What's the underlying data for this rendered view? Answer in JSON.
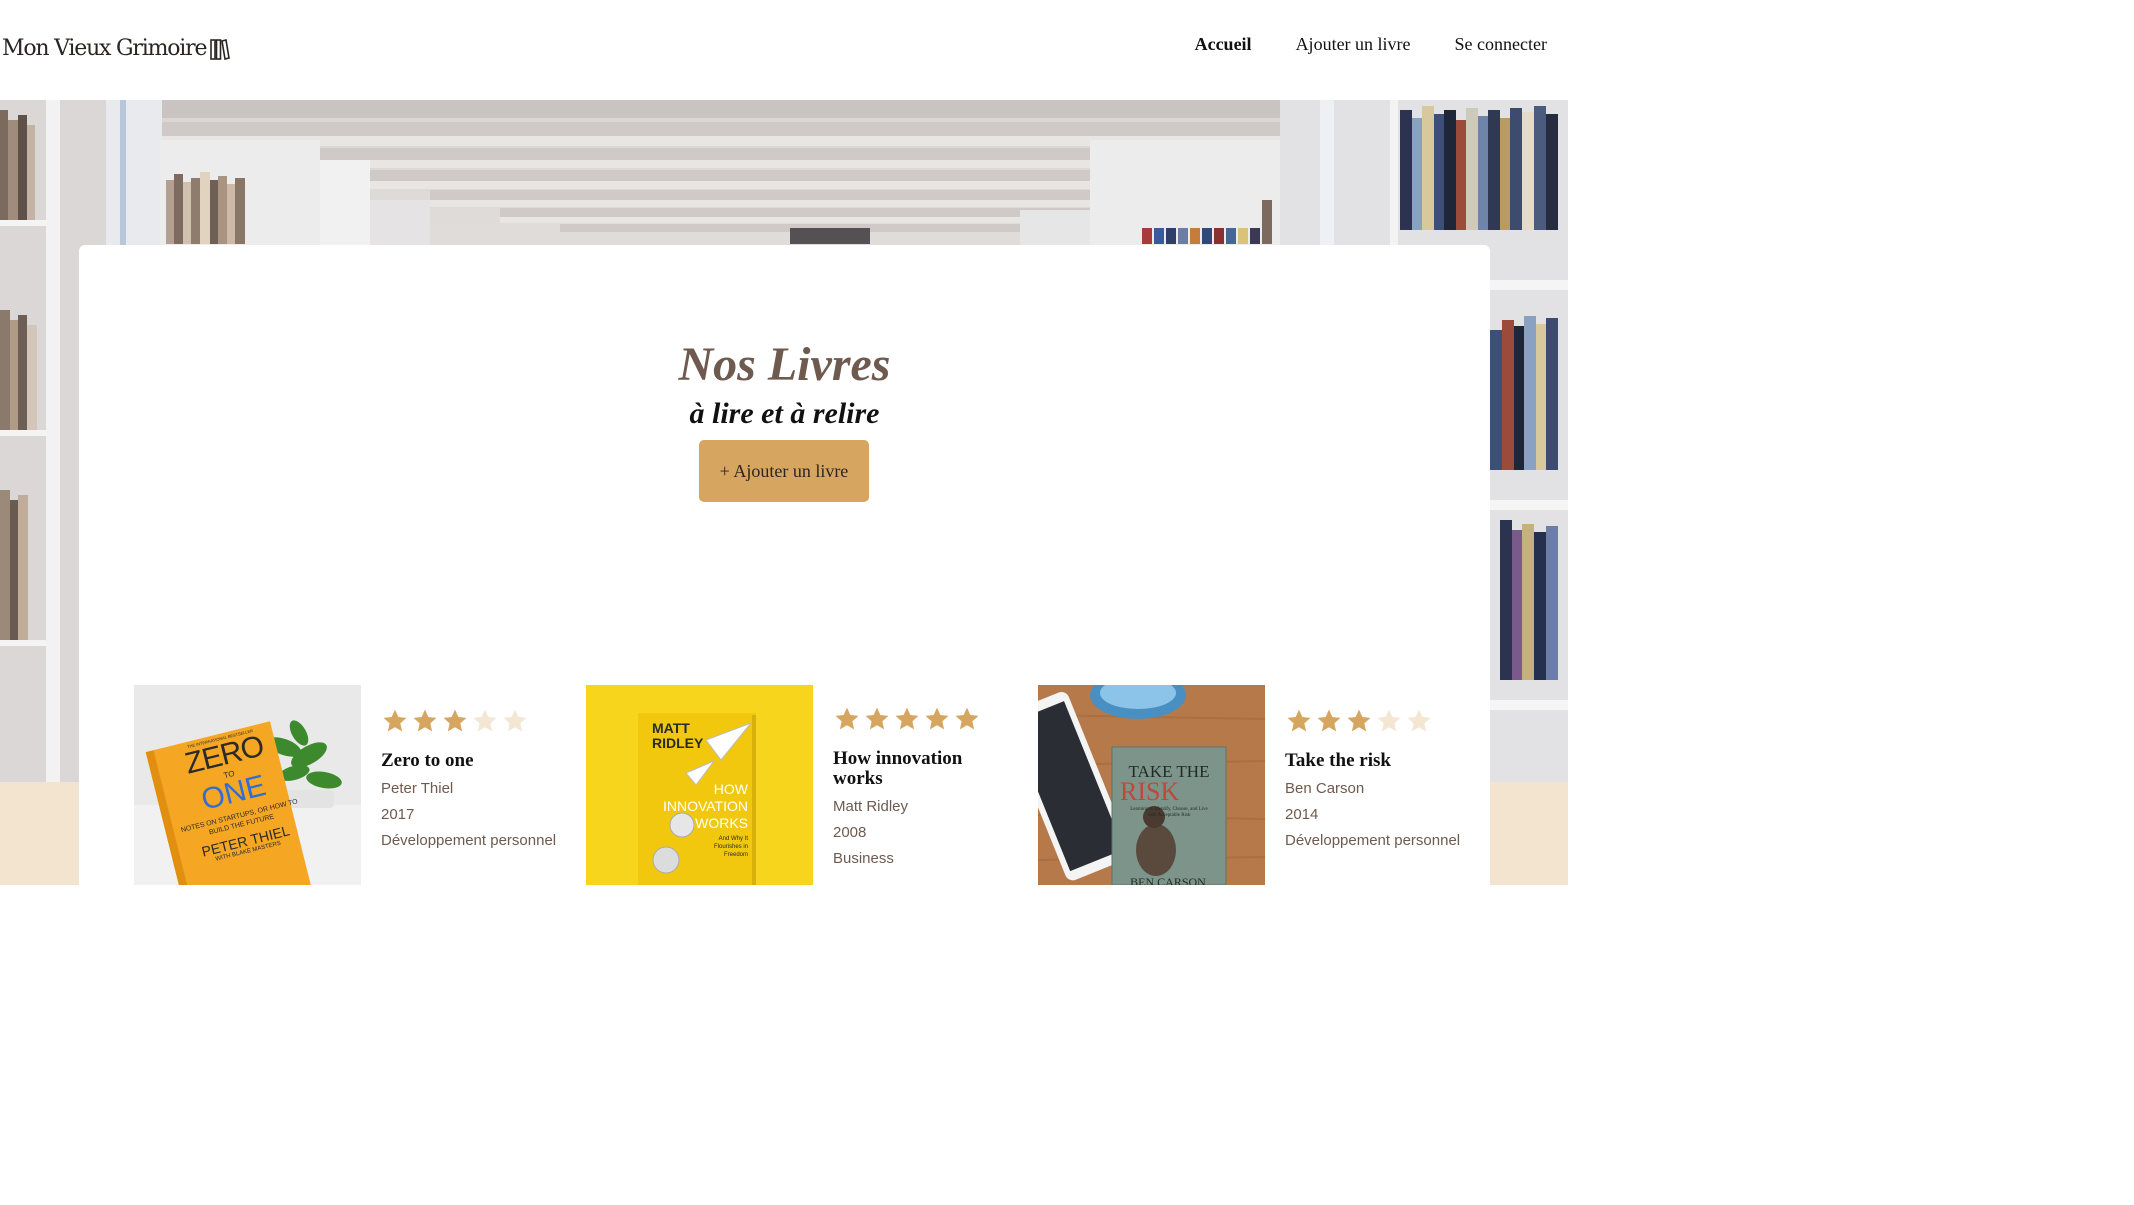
{
  "header": {
    "logo_text": "Mon Vieux Grimoire",
    "nav": [
      {
        "label": "Accueil",
        "active": true
      },
      {
        "label": "Ajouter un livre",
        "active": false
      },
      {
        "label": "Se connecter",
        "active": false
      }
    ]
  },
  "main": {
    "title": "Nos Livres",
    "subtitle": "à lire et à relire",
    "add_button_label": "+ Ajouter un livre"
  },
  "books": [
    {
      "rating": 3,
      "title": "Zero to one",
      "author": "Peter Thiel",
      "year": "2017",
      "genre": "Développement personnel",
      "cover": {
        "top_text": "THE INTERNATIONAL BESTSELLER",
        "title_word1": "ZERO",
        "title_word2": "TO",
        "title_word3": "ONE",
        "subtitle": "NOTES ON STARTUPS, OR HOW TO BUILD THE FUTURE",
        "author": "PETER THIEL",
        "coauthor": "WITH BLAKE MASTERS"
      }
    },
    {
      "rating": 5,
      "title": "How innovation works",
      "author": "Matt Ridley",
      "year": "2008",
      "genre": "Business",
      "cover": {
        "author_line1": "MATT",
        "author_line2": "RIDLEY",
        "title_line1": "HOW",
        "title_line2": "INNOVATION",
        "title_line3": "WORKS",
        "tagline": "And Why It Flourishes in Freedom"
      }
    },
    {
      "rating": 3,
      "title": "Take the risk",
      "author": "Ben Carson",
      "year": "2014",
      "genre": "Développement personnel",
      "cover": {
        "title_line1": "TAKE THE",
        "title_line2": "RISK",
        "subtitle": "Learning to Identify, Choose, and Live with Acceptable Risk",
        "author": "BEN CARSON"
      }
    }
  ],
  "colors": {
    "accent": "#d6a660",
    "title_brown": "#6e5a4f",
    "star_filled": "#d6a660",
    "star_empty": "#f3e6d2",
    "beige_band": "#f2e4cf"
  }
}
